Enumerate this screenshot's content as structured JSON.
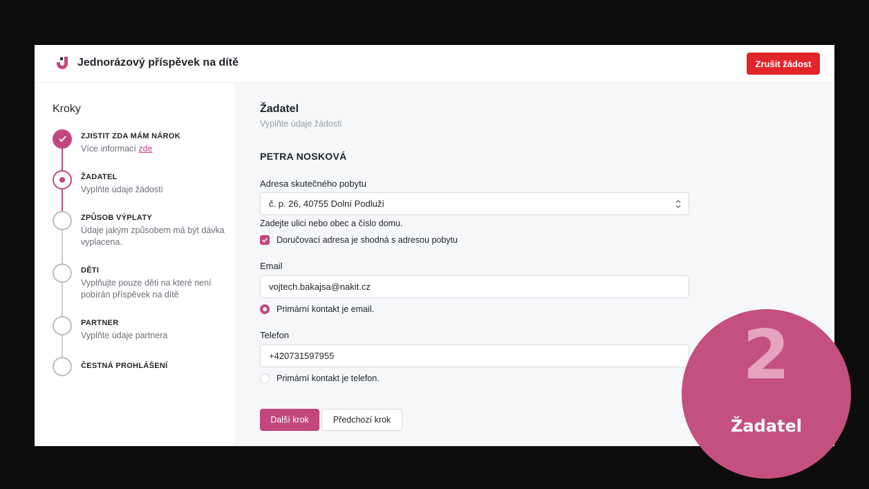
{
  "header": {
    "title": "Jednorázový příspěvek na dítě",
    "cancel_label": "Zrušit žádost"
  },
  "sidebar": {
    "title": "Kroky",
    "steps": [
      {
        "title": "ZJISTIT ZDA MÁM NÁROK",
        "desc": "Více informací",
        "link": "zde",
        "status": "done"
      },
      {
        "title": "ŽADATEL",
        "desc": "Vyplňte údaje žádosti",
        "status": "current"
      },
      {
        "title": "ZPŮSOB VÝPLATY",
        "desc": "Údaje jakým způsobem má být dávka vyplacena.",
        "status": "todo"
      },
      {
        "title": "DĚTI",
        "desc": "Vyplňujte pouze děti na které není pobírán příspěvek na dítě",
        "status": "todo"
      },
      {
        "title": "PARTNER",
        "desc": "Vyplňte údaje partnera",
        "status": "todo"
      },
      {
        "title": "ČESTNÁ PROHLÁŠENÍ",
        "desc": "",
        "status": "todo"
      }
    ]
  },
  "main": {
    "title": "Žadatel",
    "subtitle": "Vyplňte údaje žádosti",
    "person_name": "PETRA NOSKOVÁ",
    "address": {
      "label": "Adresa skutečného pobytu",
      "value": "č. p. 26, 40755 Dolní Podluží",
      "hint": "Zadejte ulici nebo obec a číslo domu.",
      "checkbox_label": "Doručovací adresa je shodná s adresou pobytu",
      "checkbox_checked": true
    },
    "email": {
      "label": "Email",
      "value": "vojtech.bakajsa@nakit.cz",
      "radio_label": "Primární kontakt je email.",
      "radio_selected": true
    },
    "phone": {
      "label": "Telefon",
      "value": "+420731597955",
      "radio_label": "Primární kontakt je telefon.",
      "radio_selected": false
    },
    "next_label": "Další krok",
    "prev_label": "Předchozí krok"
  },
  "badge": {
    "number": "2",
    "label": "Žadatel"
  },
  "colors": {
    "accent": "#c2477f",
    "danger": "#e1262b",
    "badge": "#c4507f"
  }
}
